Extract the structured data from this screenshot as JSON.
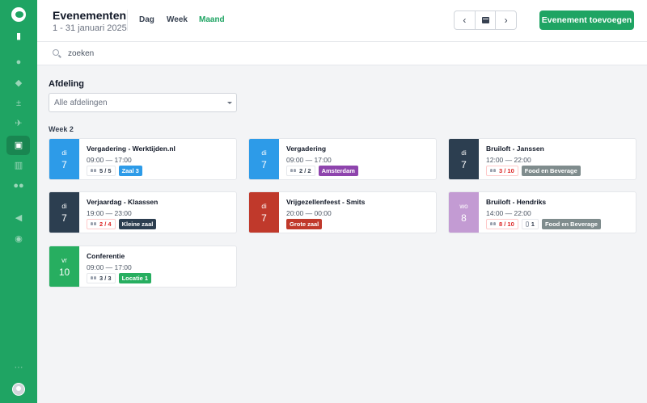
{
  "header": {
    "title": "Evenementen",
    "subtitle": "1 - 31 januari 2025",
    "view_tabs": [
      "Dag",
      "Week",
      "Maand"
    ],
    "active_view": "Maand",
    "prev_label": "‹",
    "next_label": "›",
    "add_button": "Evenement toevoegen"
  },
  "search": {
    "placeholder": "zoeken"
  },
  "filter": {
    "label": "Afdeling",
    "selected": "Alle afdelingen"
  },
  "week": {
    "label": "Week 2"
  },
  "colors": {
    "brand": "#1fa463",
    "blue": "#2d9be8",
    "navy": "#2c3e50",
    "red": "#c0392b",
    "lavender": "#c39bd3",
    "green": "#27ae60",
    "purple": "#8e44ad",
    "gray": "#7f8c8d"
  },
  "sidebar": {
    "icons": [
      "logo-icon",
      "building-icon",
      "clock-icon",
      "fire-icon",
      "plus-minus-icon",
      "plane-icon",
      "calendar-icon",
      "bar-chart-icon",
      "users-icon",
      "megaphone-icon",
      "chat-icon",
      "more-icon",
      "avatar"
    ],
    "active": "calendar-icon"
  },
  "events": [
    {
      "dow": "di",
      "day": "7",
      "date_color": "#2d9be8",
      "name": "Vergadering - Werktijden.nl",
      "time": "09:00 — 17:00",
      "count": "5 / 5",
      "count_warn": false,
      "attachments": "",
      "tag": "Zaal 3",
      "tag_color": "#2d9be8"
    },
    {
      "dow": "di",
      "day": "7",
      "date_color": "#2d9be8",
      "name": "Vergadering",
      "time": "09:00 — 17:00",
      "count": "2 / 2",
      "count_warn": false,
      "attachments": "",
      "tag": "Amsterdam",
      "tag_color": "#8e44ad"
    },
    {
      "dow": "di",
      "day": "7",
      "date_color": "#2c3e50",
      "name": "Bruiloft - Janssen",
      "time": "12:00 — 22:00",
      "count": "3 / 10",
      "count_warn": true,
      "attachments": "",
      "tag": "Food en Beverage",
      "tag_color": "#7f8c8d"
    },
    {
      "dow": "di",
      "day": "7",
      "date_color": "#2c3e50",
      "name": "Verjaardag - Klaassen",
      "time": "19:00 — 23:00",
      "count": "2 / 4",
      "count_warn": true,
      "attachments": "",
      "tag": "Kleine zaal",
      "tag_color": "#2c3e50"
    },
    {
      "dow": "di",
      "day": "7",
      "date_color": "#c0392b",
      "name": "Vrijgezellenfeest - Smits",
      "time": "20:00 — 00:00",
      "count": "",
      "count_warn": false,
      "attachments": "",
      "tag": "Grote zaal",
      "tag_color": "#c0392b"
    },
    {
      "dow": "wo",
      "day": "8",
      "date_color": "#c39bd3",
      "name": "Bruiloft - Hendriks",
      "time": "14:00 — 22:00",
      "count": "8 / 10",
      "count_warn": true,
      "attachments": "1",
      "tag": "Food en Beverage",
      "tag_color": "#7f8c8d"
    },
    {
      "dow": "vr",
      "day": "10",
      "date_color": "#27ae60",
      "name": "Conferentie",
      "time": "09:00 — 17:00",
      "count": "3 / 3",
      "count_warn": false,
      "attachments": "",
      "tag": "Locatie 1",
      "tag_color": "#27ae60"
    }
  ]
}
